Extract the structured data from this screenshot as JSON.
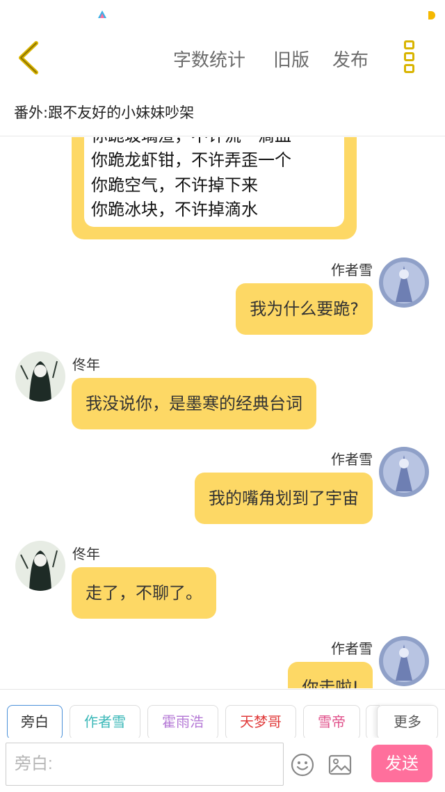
{
  "header": {
    "word_count_label": "字数统计",
    "old_version_label": "旧版",
    "publish_label": "发布"
  },
  "chapter": {
    "title": "番外:跟不友好的小妹妹吵架"
  },
  "image_message": {
    "lines": [
      "你跪玻璃渣，不许流一滴血",
      "你跪龙虾钳，不许弄歪一个",
      "你跪空气，不许掉下来",
      "你跪冰块，不许掉滴水"
    ]
  },
  "messages": [
    {
      "sender": "作者雪",
      "text": "我为什么要跪?"
    },
    {
      "sender": "佟年",
      "text": "我没说你，是墨寒的经典台词"
    },
    {
      "sender": "作者雪",
      "text": "我的嘴角划到了宇宙"
    },
    {
      "sender": "佟年",
      "text": "走了，不聊了。"
    },
    {
      "sender": "作者雪",
      "text": "你走啦!"
    }
  ],
  "roles": [
    {
      "label": "旁白",
      "color": "#555555"
    },
    {
      "label": "作者雪",
      "color": "#3bb8b8"
    },
    {
      "label": "霍雨浩",
      "color": "#b57ad6"
    },
    {
      "label": "天梦哥",
      "color": "#e03a3a"
    },
    {
      "label": "雪帝",
      "color": "#e0508a"
    }
  ],
  "more_label": "更多",
  "input": {
    "placeholder": "旁白:"
  },
  "send_label": "发送",
  "colors": {
    "accent": "#fdd865",
    "send": "#ff6f9c",
    "icon": "#d9b400"
  }
}
